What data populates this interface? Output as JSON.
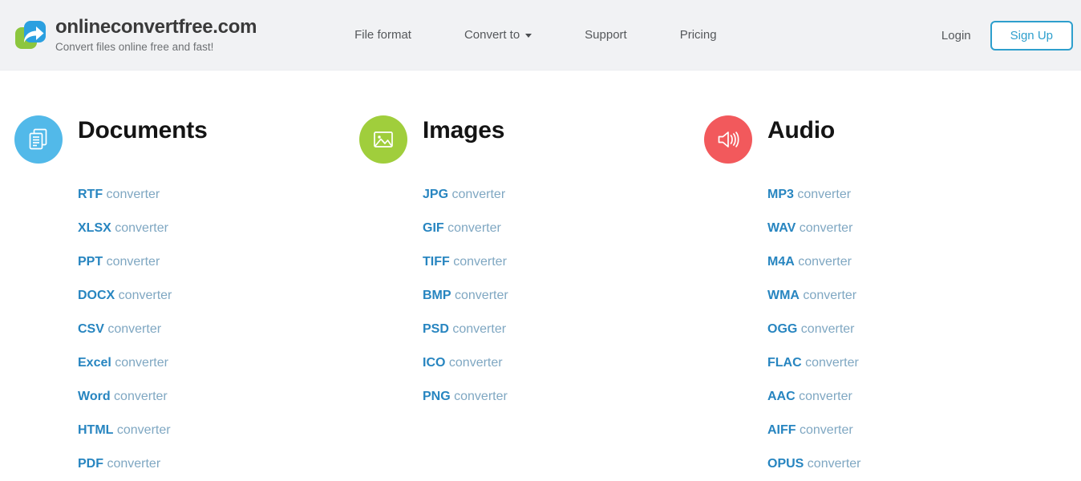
{
  "header": {
    "logo_icon": "convert-arrow-logo",
    "logo_colors": {
      "green": "#8cc63e",
      "blue": "#2ba0e0"
    },
    "brand_title": "onlineconvertfree.com",
    "brand_tagline": "Convert files online free and fast!",
    "nav": [
      {
        "label": "File format",
        "has_dropdown": false
      },
      {
        "label": "Convert to",
        "has_dropdown": true,
        "icon": "chevron-down-icon"
      },
      {
        "label": "Support",
        "has_dropdown": false
      },
      {
        "label": "Pricing",
        "has_dropdown": false
      }
    ],
    "login_label": "Login",
    "signup_label": "Sign Up",
    "accent_color": "#2e9fcd",
    "background_color": "#f1f2f4"
  },
  "main": {
    "columns": [
      {
        "title": "Documents",
        "icon": "documents-icon",
        "icon_color": "#52b9e9",
        "links": [
          {
            "format": "RTF",
            "suffix": " converter"
          },
          {
            "format": "XLSX",
            "suffix": " converter"
          },
          {
            "format": "PPT",
            "suffix": " converter"
          },
          {
            "format": "DOCX",
            "suffix": " converter"
          },
          {
            "format": "CSV",
            "suffix": " converter"
          },
          {
            "format": "Excel",
            "suffix": " converter"
          },
          {
            "format": "Word",
            "suffix": " converter"
          },
          {
            "format": "HTML",
            "suffix": " converter"
          },
          {
            "format": "PDF",
            "suffix": " converter"
          }
        ]
      },
      {
        "title": "Images",
        "icon": "images-icon",
        "icon_color": "#a0ce3c",
        "links": [
          {
            "format": "JPG",
            "suffix": " converter"
          },
          {
            "format": "GIF",
            "suffix": " converter"
          },
          {
            "format": "TIFF",
            "suffix": " converter"
          },
          {
            "format": "BMP",
            "suffix": " converter"
          },
          {
            "format": "PSD",
            "suffix": " converter"
          },
          {
            "format": "ICO",
            "suffix": " converter"
          },
          {
            "format": "PNG",
            "suffix": " converter"
          }
        ]
      },
      {
        "title": "Audio",
        "icon": "audio-speaker-icon",
        "icon_color": "#f2595c",
        "links": [
          {
            "format": "MP3",
            "suffix": " converter"
          },
          {
            "format": "WAV",
            "suffix": " converter"
          },
          {
            "format": "M4A",
            "suffix": " converter"
          },
          {
            "format": "WMA",
            "suffix": " converter"
          },
          {
            "format": "OGG",
            "suffix": " converter"
          },
          {
            "format": "FLAC",
            "suffix": " converter"
          },
          {
            "format": "AAC",
            "suffix": " converter"
          },
          {
            "format": "AIFF",
            "suffix": " converter"
          },
          {
            "format": "OPUS",
            "suffix": " converter"
          }
        ]
      }
    ],
    "link_format_color": "#2785c0",
    "link_suffix_color": "#7fa7c2"
  }
}
